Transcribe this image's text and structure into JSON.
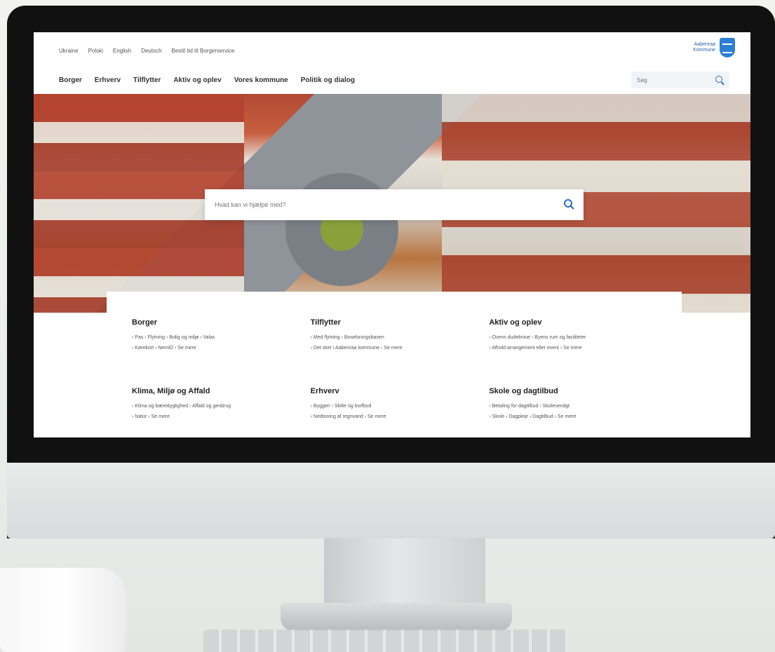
{
  "topbar": {
    "lang_links": [
      "Ukraine",
      "Polski",
      "English",
      "Deutsch",
      "Bestil tid til Borgerservice"
    ],
    "logo_line1": "Aabenraa",
    "logo_line2": "Kommune"
  },
  "nav": {
    "items": [
      "Borger",
      "Erhverv",
      "Tilflytter",
      "Aktiv og oplev",
      "Vores kommune",
      "Politik og dialog"
    ],
    "search_placeholder": "Søg"
  },
  "hero": {
    "search_placeholder": "Hvad kan vi hjælpe med?"
  },
  "cards": [
    {
      "title": "Borger",
      "links_line1": "› Pas  › Flytning  › Bolig og miljø  › Valas",
      "links_line2": "› Kørekort  › NemID  › Se mere"
    },
    {
      "title": "Tilflytter",
      "links_line1": "› Med flytning  › Boselsningsbasen",
      "links_line2": "› Det sker i Aabenraa kommune  › Se mere"
    },
    {
      "title": "Aktiv og oplev",
      "links_line1": "› Ovens dudelmiue  › Byens rum og faciliteter",
      "links_line2": "› Afhold arrangement eller event  › Se mere"
    },
    {
      "title": "Klima, Miljø og Affald",
      "links_line1": "› Klima og bæredygtighed  › Affald og genbrug",
      "links_line2": "› Natur  › Se mere"
    },
    {
      "title": "Erhverv",
      "links_line1": "› Byggeri  › Skilte og borfbud",
      "links_line2": "› Nedtoning af regnvand  › Se mere"
    },
    {
      "title": "Skole og dagtilbud",
      "links_line1": "› Betaling for dagtilbud  › Skolevendgt",
      "links_line2": "› Skole  › Dagpleje  › Dagtilbud  › Se mere"
    }
  ]
}
